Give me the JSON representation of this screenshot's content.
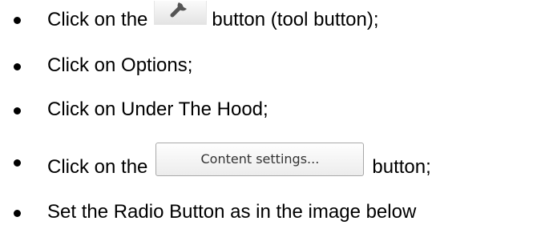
{
  "steps": [
    {
      "before": "Click on the",
      "after": "button (tool button);",
      "icon": "wrench-icon"
    },
    {
      "text": "Click on Options;"
    },
    {
      "text": "Click on Under The Hood;"
    },
    {
      "before": "Click on the",
      "button_label": "Content settings...",
      "after": "button;"
    },
    {
      "text": "Set the Radio Button as in the image below"
    }
  ]
}
